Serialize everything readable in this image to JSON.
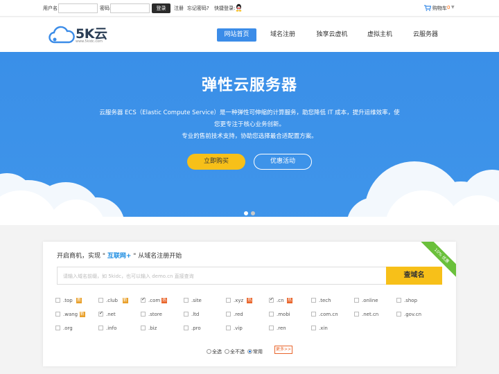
{
  "topbar": {
    "username_label": "用户名:",
    "password_label": "密码:",
    "login_button": "登录",
    "register_link": "注册",
    "forgot_link": "忘记密码?",
    "quick_login_label": "快捷登录:",
    "cart_label": "购物车",
    "cart_count": "0"
  },
  "header": {
    "logo_text": "5K云",
    "logo_url": "www.5kidc.com",
    "nav": [
      "网站首页",
      "域名注册",
      "独享云虚机",
      "虚拟主机",
      "云服务器"
    ],
    "active_nav": 0
  },
  "banner": {
    "title": "弹性云服务器",
    "desc_line1": "云服务器 ECS（Elastic Compute Service）是一种弹性可伸缩的计算服务，助您降低 IT 成本，提升运维效率，使",
    "desc_line2": "您更专注于核心业务创新。",
    "desc_line3": "专业的售前技术支持，协助您选择最合适配置方案。",
    "buy_button": "立即购买",
    "promo_button": "优惠活动",
    "slide_count": 2,
    "active_slide": 0
  },
  "domain": {
    "tagline_pre": "开启商机，实现 \" ",
    "tagline_brand": "互联网+",
    "tagline_post": " \" 从域名注册开始",
    "ribbon": "10% 优惠",
    "search_placeholder": "请输入域名前缀，如 5kidc，也可以输入 demo.cn 直接查询",
    "search_button": "查域名",
    "tlds": [
      {
        "name": ".top",
        "checked": false,
        "badge": "new"
      },
      {
        "name": ".club",
        "checked": false,
        "badge": "new"
      },
      {
        "name": ".com",
        "checked": true,
        "badge": "hot"
      },
      {
        "name": ".site",
        "checked": false,
        "badge": ""
      },
      {
        "name": ".xyz",
        "checked": false,
        "badge": "hot"
      },
      {
        "name": ".cn",
        "checked": true,
        "badge": "hot"
      },
      {
        "name": ".tech",
        "checked": false,
        "badge": ""
      },
      {
        "name": ".online",
        "checked": false,
        "badge": ""
      },
      {
        "name": ".shop",
        "checked": false,
        "badge": ""
      },
      {
        "name": ".wang",
        "checked": false,
        "badge": "new"
      },
      {
        "name": ".net",
        "checked": true,
        "badge": ""
      },
      {
        "name": ".store",
        "checked": false,
        "badge": ""
      },
      {
        "name": ".ltd",
        "checked": false,
        "badge": ""
      },
      {
        "name": ".red",
        "checked": false,
        "badge": ""
      },
      {
        "name": ".mobi",
        "checked": false,
        "badge": ""
      },
      {
        "name": ".com.cn",
        "checked": false,
        "badge": ""
      },
      {
        "name": ".net.cn",
        "checked": false,
        "badge": ""
      },
      {
        "name": ".gov.cn",
        "checked": false,
        "badge": ""
      },
      {
        "name": ".org",
        "checked": false,
        "badge": ""
      },
      {
        "name": ".info",
        "checked": false,
        "badge": ""
      },
      {
        "name": ".biz",
        "checked": false,
        "badge": ""
      },
      {
        "name": ".pro",
        "checked": false,
        "badge": ""
      },
      {
        "name": ".vip",
        "checked": false,
        "badge": ""
      },
      {
        "name": ".ren",
        "checked": false,
        "badge": ""
      },
      {
        "name": ".xin",
        "checked": false,
        "badge": ""
      }
    ],
    "badge_text": {
      "hot": "热",
      "new": "新"
    },
    "radio_all": "全选",
    "radio_none": "全不选",
    "radio_common": "常用",
    "radio_selected": "common",
    "more_button": "更多>>"
  },
  "colors": {
    "accent": "#3b8ce8",
    "banner": "#3a8fe8",
    "cta": "#f7c019",
    "hot": "#e9652b",
    "ribbon": "#6ac03b"
  }
}
